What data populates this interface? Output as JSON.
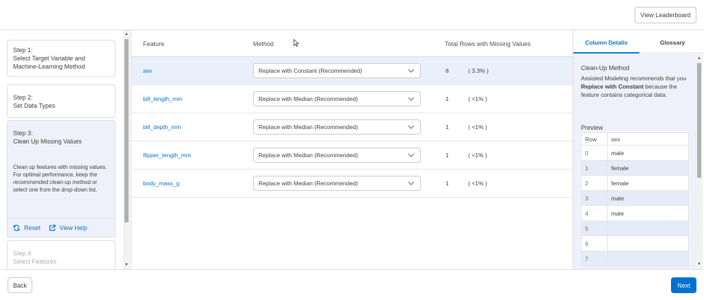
{
  "header": {
    "leaderboard_label": "View Leaderboard"
  },
  "steps": [
    {
      "label": "Step 1:\nSelect Target Variable and\nMachine-Learning Method",
      "state": "complete"
    },
    {
      "label": "Step 2:\nSet Data Types",
      "state": "complete"
    },
    {
      "label": "Step 3:\nClean Up Missing Values",
      "state": "active",
      "description": "Clean up features with missing values. For optimal performance, keep the recommended clean-up method or select one from the drop-down list."
    },
    {
      "label": "Step 4:\nSelect Features",
      "state": "disabled"
    }
  ],
  "step_actions": {
    "reset_label": "Reset",
    "help_label": "View Help"
  },
  "table": {
    "columns": {
      "feature": "Feature",
      "method": "Method",
      "rows": "Total Rows with Missing Values"
    },
    "rows": [
      {
        "feature": "sex",
        "method": "Replace with Constant (Recommended)",
        "count": "8",
        "percent": "( 3.3% )",
        "selected": true
      },
      {
        "feature": "bill_length_mm",
        "method": "Replace with Median (Recommended)",
        "count": "1",
        "percent": "( <1% )",
        "selected": false
      },
      {
        "feature": "bill_depth_mm",
        "method": "Replace with Median (Recommended)",
        "count": "1",
        "percent": "( <1% )",
        "selected": false
      },
      {
        "feature": "flipper_length_mm",
        "method": "Replace with Median (Recommended)",
        "count": "1",
        "percent": "( <1% )",
        "selected": false
      },
      {
        "feature": "body_mass_g",
        "method": "Replace with Median (Recommended)",
        "count": "1",
        "percent": "( <1% )",
        "selected": false
      }
    ]
  },
  "side_panel": {
    "tabs": [
      "Column Details",
      "Glossary"
    ],
    "active_tab": "Column Details",
    "cleanup_title": "Clean-Up Method",
    "cleanup_text_1": "Assisted Modeling recommends that you ",
    "cleanup_text_bold": "Replace with Constant",
    "cleanup_text_2": " because the feature contains categorical data.",
    "preview_title": "Preview",
    "preview_columns": [
      "Row",
      "sex"
    ],
    "preview_rows": [
      [
        "0",
        "male"
      ],
      [
        "1",
        "female"
      ],
      [
        "2",
        "female"
      ],
      [
        "3",
        "male"
      ],
      [
        "4",
        "male"
      ],
      [
        "5",
        ""
      ],
      [
        "6",
        ""
      ],
      [
        "7",
        ""
      ]
    ]
  },
  "footer": {
    "back_label": "Back",
    "next_label": "Next"
  },
  "colors": {
    "accent": "#0070d2",
    "active_bg": "#eef1f9"
  },
  "icons": {
    "reset": "refresh-icon",
    "help": "external-link-icon",
    "dropdown": "chevron-down-icon"
  }
}
